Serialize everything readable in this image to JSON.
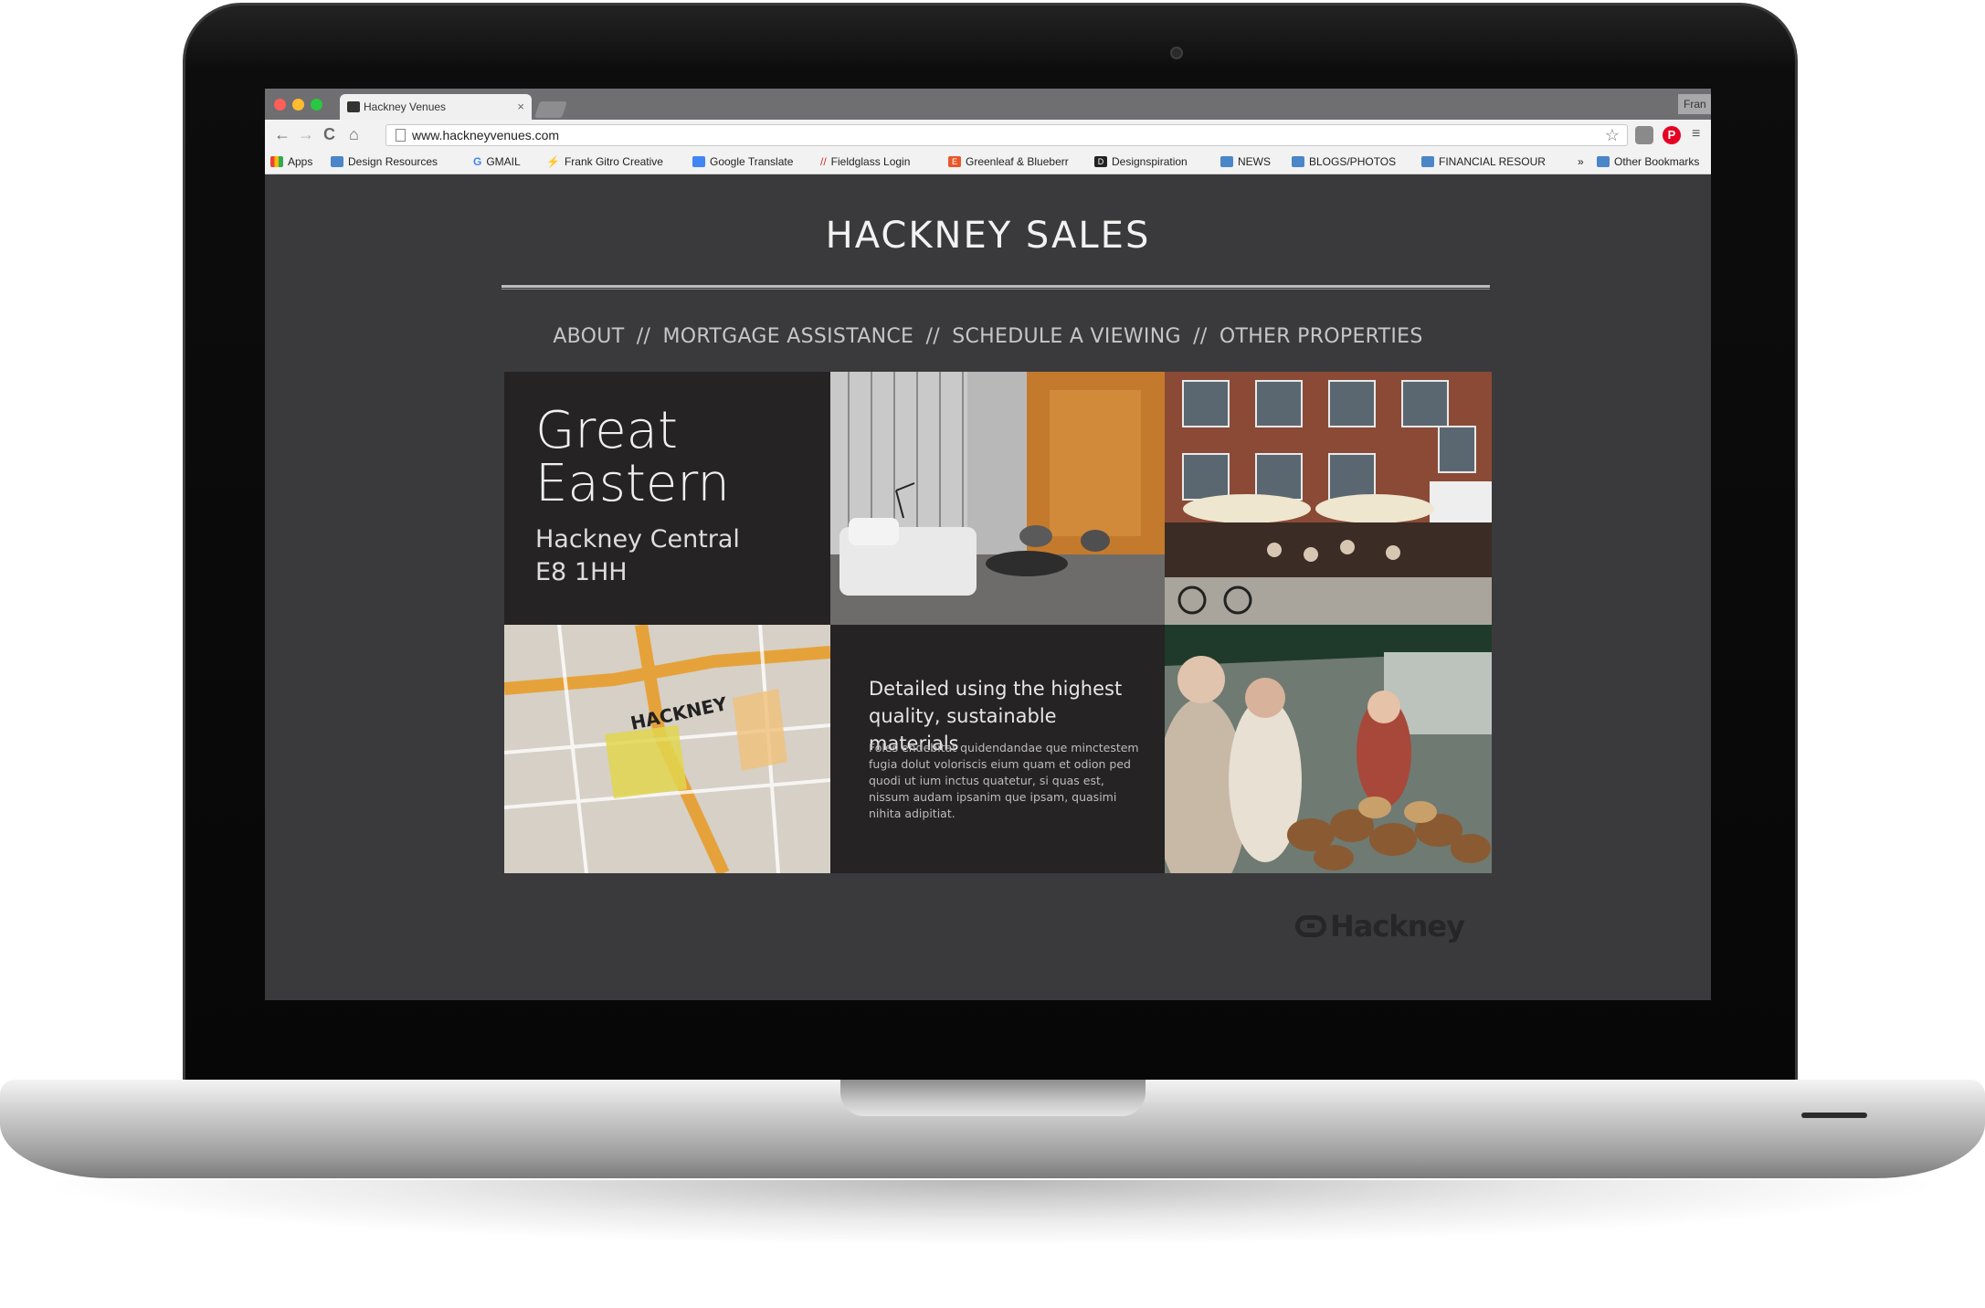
{
  "browser": {
    "tab_title": "Hackney Venues",
    "tab_close": "×",
    "profile": "Fran",
    "url": "www.hackneyvenues.com",
    "nav": {
      "back": "←",
      "forward": "→",
      "reload": "C",
      "home": "⌂"
    },
    "star": "☆",
    "pinterest": "P",
    "menu": "≡",
    "bookmarks": {
      "apps": "Apps",
      "design_resources": "Design Resources",
      "gmail_glyph": "G",
      "gmail": "GMAIL",
      "frank_glyph": "⚡",
      "frank": "Frank Gitro Creative",
      "google_translate": "Google Translate",
      "fieldglass_glyph": "//",
      "fieldglass": "Fieldglass Login",
      "greenleaf_glyph": "E",
      "greenleaf": "Greenleaf & Blueberr",
      "designspiration_glyph": "D",
      "designspiration": "Designspiration",
      "news": "NEWS",
      "blogs": "BLOGS/PHOTOS",
      "financial": "FINANCIAL RESOUR",
      "more": "»",
      "other": "Other Bookmarks"
    }
  },
  "site": {
    "title": "HACKNEY SALES",
    "nav": {
      "about": "ABOUT",
      "mortgage": "MORTGAGE ASSISTANCE",
      "schedule": "SCHEDULE A VIEWING",
      "other": "OTHER PROPERTIES",
      "separator": "//"
    },
    "property": {
      "name_line1": "Great",
      "name_line2": "Eastern",
      "area": "Hackney Central",
      "postcode": "E8 1HH"
    },
    "detail": {
      "heading": "Detailed using the highest quality, sustainable materials",
      "body": "Foles endebitat quidendandae que minctestem fugia dolut voloriscis eium quam et odion ped quodi ut ium inctus quatetur, si quas est, nissum audam ipsanim que ipsam, quasimi nihita adipitiat."
    },
    "map_label": "HACKNEY",
    "logo": "Hackney"
  },
  "colors": {
    "page_bg": "#3a3a3c",
    "panel_bg": "#252324",
    "title_text": "#f2f2f2",
    "nav_text": "#c6c6c6"
  }
}
